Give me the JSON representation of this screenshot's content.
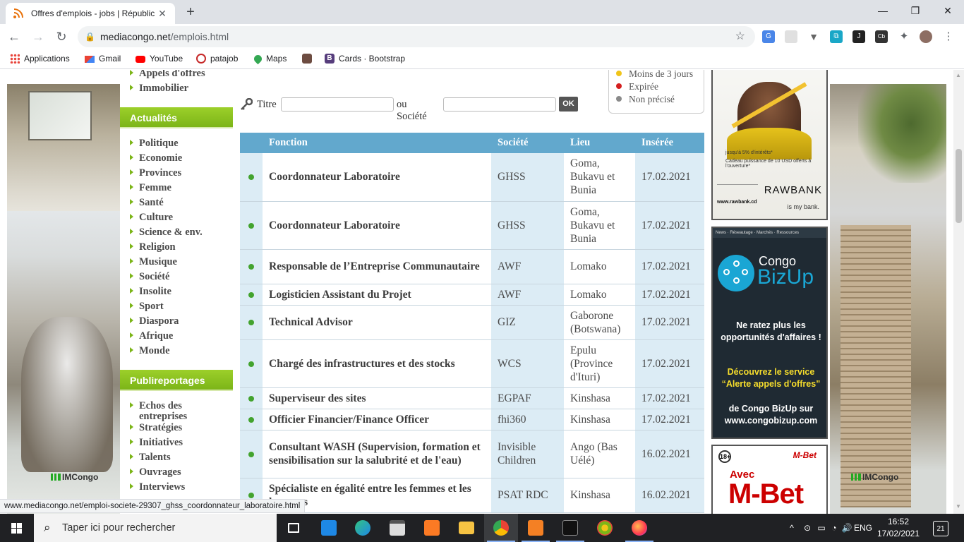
{
  "browser": {
    "tab_title": "Offres d'emplois - jobs | Républic",
    "url_domain": "mediacongo.net",
    "url_path": "/emplois.html",
    "bookmarks": [
      "Applications",
      "Gmail",
      "YouTube",
      "patajob",
      "Maps",
      "Cards · Bootstrap"
    ]
  },
  "sidebar": {
    "top_items": [
      "Appels d'offres",
      "Immobilier"
    ],
    "actualites_title": "Actualités",
    "actualites": [
      "Politique",
      "Economie",
      "Provinces",
      "Femme",
      "Santé",
      "Culture",
      "Science & env.",
      "Religion",
      "Musique",
      "Société",
      "Insolite",
      "Sport",
      "Diaspora",
      "Afrique",
      "Monde"
    ],
    "publireportages_title": "Publireportages",
    "publireportages": [
      "Echos des entreprises",
      "Stratégies",
      "Initiatives",
      "Talents",
      "Ouvrages",
      "Interviews"
    ]
  },
  "search": {
    "title_label": "Titre",
    "company_label": "ou Société",
    "ok_label": "OK"
  },
  "legend": [
    {
      "label": "Moins de 3 jours",
      "color": "#f0c419"
    },
    {
      "label": "Expirée",
      "color": "#d41f1f"
    },
    {
      "label": "Non précisé",
      "color": "#8a8a8a"
    }
  ],
  "table": {
    "headers": {
      "fonction": "Fonction",
      "societe": "Société",
      "lieu": "Lieu",
      "inseree": "Insérée"
    },
    "rows": [
      {
        "fonction": "Coordonnateur Laboratoire",
        "societe": "GHSS",
        "lieu": "Goma, Bukavu et Bunia",
        "date": "17.02.2021"
      },
      {
        "fonction": "Coordonnateur Laboratoire",
        "societe": "GHSS",
        "lieu": "Goma, Bukavu et Bunia",
        "date": "17.02.2021"
      },
      {
        "fonction": "Responsable de l’Entreprise Communautaire",
        "societe": "AWF",
        "lieu": "Lomako",
        "date": "17.02.2021"
      },
      {
        "fonction": "Logisticien Assistant du Projet",
        "societe": "AWF",
        "lieu": "Lomako",
        "date": "17.02.2021"
      },
      {
        "fonction": "Technical Advisor",
        "societe": "GIZ",
        "lieu": "Gaborone (Botswana)",
        "date": "17.02.2021"
      },
      {
        "fonction": "Chargé des infrastructures et des stocks",
        "societe": "WCS",
        "lieu": "Epulu (Province d'Ituri)",
        "date": "17.02.2021"
      },
      {
        "fonction": "Superviseur des sites",
        "societe": "EGPAF",
        "lieu": "Kinshasa",
        "date": "17.02.2021"
      },
      {
        "fonction": "Officier Financier/Finance Officer",
        "societe": "fhi360",
        "lieu": "Kinshasa",
        "date": "17.02.2021"
      },
      {
        "fonction": "Consultant WASH (Supervision, formation et sensibilisation sur la salubrité et de l'eau)",
        "societe": "Invisible Children",
        "lieu": "Ango (Bas Uélé)",
        "date": "16.02.2021"
      },
      {
        "fonction": "Spécialiste en égalité entre les femmes et les hommes",
        "societe": "PSAT RDC",
        "lieu": "Kinshasa",
        "date": "16.02.2021"
      }
    ]
  },
  "ads": {
    "rawbank": {
      "brand": "RAWBANK",
      "tagline": "is my bank.",
      "url": "www.rawbank.cd",
      "line1": "jusqu'à 5% d'intérêts*",
      "line2": "Cadeau puissance de 10 USD offerts à l'ouverture*"
    },
    "bizup": {
      "nav": "News · Réseautage · Marchés · Ressources",
      "brand1": "Congo",
      "brand2": "BizUp",
      "msg1": "Ne ratez plus les opportunités d'affaires !",
      "msg2": "Découvrez le service “Alerte appels d'offres”",
      "msg3": "de Congo BizUp sur www.congobizup.com"
    },
    "mbet": {
      "age": "18+",
      "logo": "M-Bet",
      "avec": "Avec",
      "big": "M-Bet"
    }
  },
  "watermark": "IMCongo",
  "status_url": "www.mediacongo.net/emploi-societe-29307_ghss_coordonnateur_laboratoire.html",
  "taskbar": {
    "search_placeholder": "Taper ici pour rechercher",
    "lang": "ENG",
    "time": "16:52",
    "date": "17/02/2021",
    "notifications": "21"
  }
}
